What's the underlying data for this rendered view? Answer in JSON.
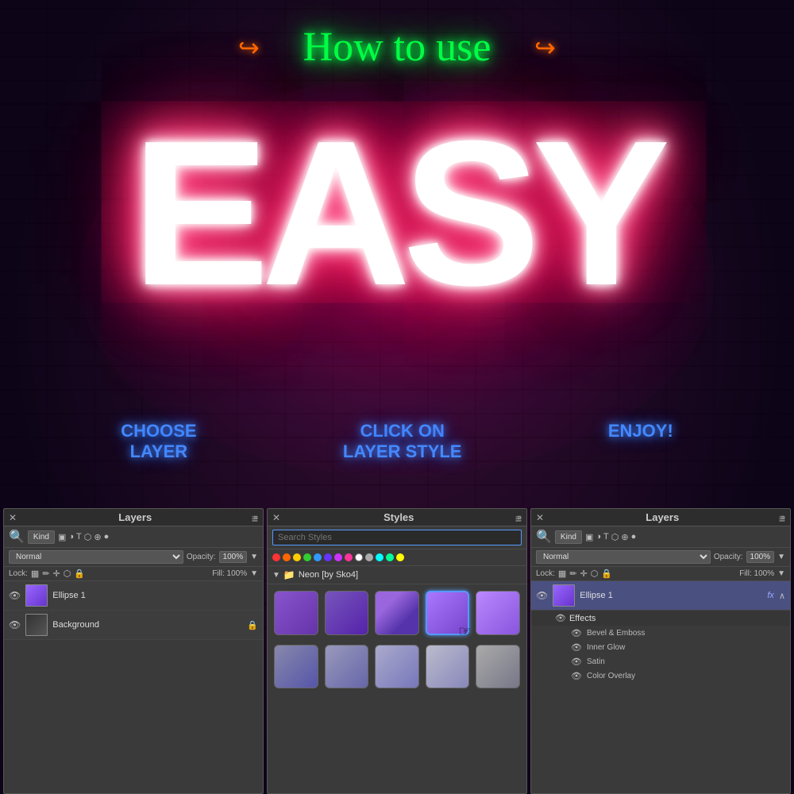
{
  "canvas": {
    "background_color": "#1a0a1e"
  },
  "header": {
    "how_to_use": "How to use"
  },
  "easy_text": "EASY",
  "steps": [
    {
      "id": "step1",
      "label": "CHOOSE\nLAYER"
    },
    {
      "id": "step2",
      "label": "CLICK ON\nLAYER STYLE"
    },
    {
      "id": "step3",
      "label": "ENJOY!"
    }
  ],
  "panel_left": {
    "title": "Layers",
    "close": "✕",
    "collapse": "»",
    "toolbar_kind": "Kind",
    "blend_mode": "Normal",
    "blend_mode_label": "Normal",
    "opacity_label": "Opacity:",
    "opacity_value": "100%",
    "lock_label": "Lock:",
    "fill_label": "Fill: 100%",
    "layers": [
      {
        "name": "Ellipse 1",
        "type": "shape",
        "has_fx": false
      },
      {
        "name": "Background",
        "type": "bg",
        "locked": true
      }
    ]
  },
  "panel_styles": {
    "title": "Styles",
    "close": "✕",
    "collapse": "»",
    "search_placeholder": "Search Styles",
    "group_name": "Neon [by Sko4]",
    "color_dots": [
      "#ff3333",
      "#ff6600",
      "#ffcc00",
      "#33cc33",
      "#3399ff",
      "#6633ff",
      "#cc33ff",
      "#ff3399",
      "#ffffff",
      "#cccccc",
      "#00ffff",
      "#00ff99",
      "#ffff00"
    ],
    "swatches_row1": [
      {
        "bg": "linear-gradient(135deg, #8855cc, #6633aa)",
        "selected": false
      },
      {
        "bg": "linear-gradient(135deg, #7755bb, #5522aa)",
        "selected": false
      },
      {
        "bg": "linear-gradient(135deg, #9966dd 30%, #5533aa 70%)",
        "selected": false
      },
      {
        "bg": "linear-gradient(135deg, #aa77ff, #7744cc)",
        "selected": true
      },
      {
        "bg": "linear-gradient(135deg, #bb88ff, #8855dd)",
        "selected": false
      }
    ],
    "swatches_row2": [
      {
        "bg": "linear-gradient(135deg, #8888aa, #5555aa)",
        "selected": false
      },
      {
        "bg": "linear-gradient(135deg, #9999bb, #6666aa)",
        "selected": false
      },
      {
        "bg": "linear-gradient(135deg, #aaaacc, #7777bb)",
        "selected": false
      },
      {
        "bg": "linear-gradient(135deg, #bbbbcc, #8888bb)",
        "selected": false
      },
      {
        "bg": "linear-gradient(135deg, #aaaaaa, #777788)",
        "selected": false
      }
    ]
  },
  "panel_right": {
    "title": "Layers",
    "close": "✕",
    "collapse": "»",
    "toolbar_kind": "Kind",
    "blend_mode": "Normal",
    "blend_mode_label": "Normal",
    "opacity_label": "Opacity:",
    "opacity_value": "100%",
    "lock_label": "Lock:",
    "fill_label": "Fill: 100%",
    "layers": [
      {
        "name": "Ellipse 1",
        "type": "shape",
        "has_fx": true
      },
      {
        "name": "Effects",
        "is_group": true
      },
      {
        "name": "Bevel & Emboss",
        "is_effect": true
      },
      {
        "name": "Inner Glow",
        "is_effect": true
      },
      {
        "name": "Satin",
        "is_effect": true
      },
      {
        "name": "Color Overlay",
        "is_effect": true
      }
    ]
  }
}
